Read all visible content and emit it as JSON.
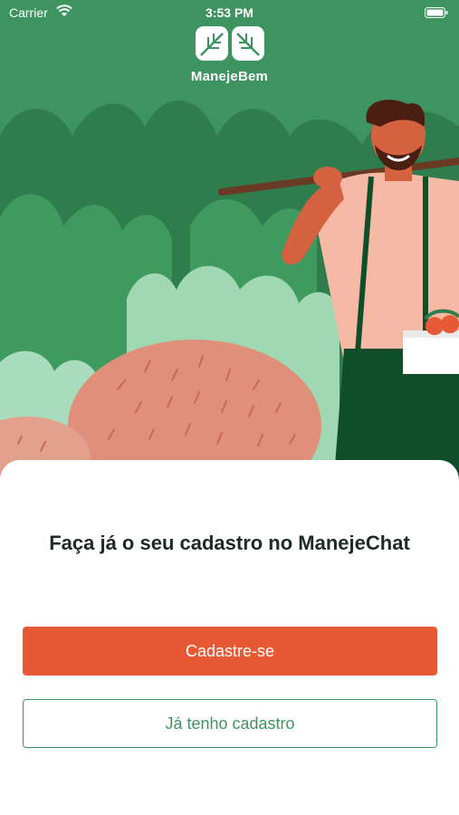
{
  "status_bar": {
    "carrier": "Carrier",
    "time": "3:53 PM"
  },
  "brand": {
    "name": "ManejeBem"
  },
  "onboarding": {
    "headline": "Faça já o seu cadastro no ManejeChat",
    "signup_label": "Cadastre-se",
    "login_label": "Já tenho cadastro"
  },
  "colors": {
    "primary_green": "#3e9461",
    "accent_orange": "#e55a35",
    "text_dark": "#1f2a24"
  }
}
